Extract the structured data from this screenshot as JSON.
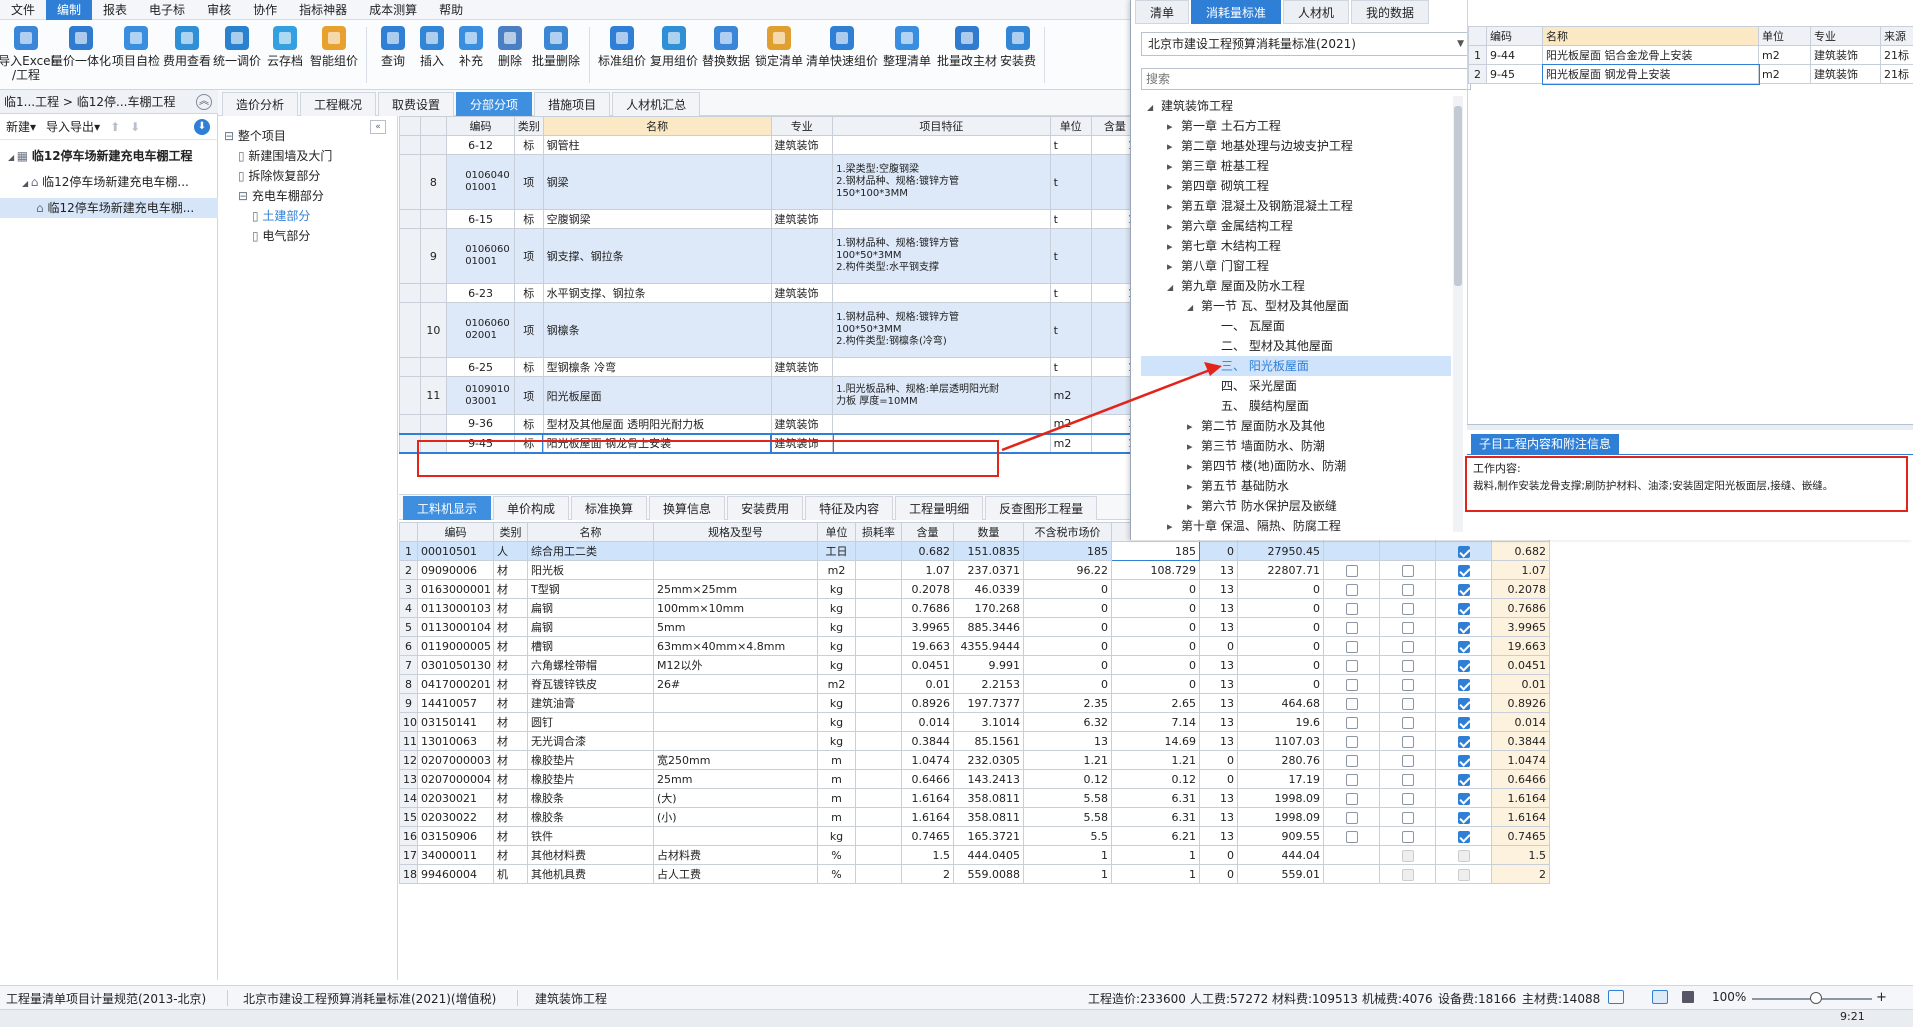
{
  "menu": [
    "文件",
    "编制",
    "报表",
    "电子标",
    "审核",
    "协作",
    "指标神器",
    "成本测算",
    "帮助"
  ],
  "menu_active": "编制",
  "ribbon": [
    {
      "label": "导入Excel\n/工程",
      "color": "#3a86d9",
      "icon": "import-excel-icon"
    },
    {
      "label": "量价一体化",
      "color": "#2e7bd0",
      "icon": "integration-icon"
    },
    {
      "label": "项目自检",
      "color": "#3a8ee0",
      "icon": "self-check-icon"
    },
    {
      "label": "费用查看",
      "color": "#2f90d8",
      "icon": "fee-view-icon"
    },
    {
      "label": "统一调价",
      "color": "#2a82cf",
      "icon": "price-adjust-icon"
    },
    {
      "label": "云存档",
      "color": "#34a0e0",
      "icon": "cloud-archive-icon"
    },
    {
      "label": "智能组价",
      "color": "#e8a12e",
      "icon": "smart-pricing-icon"
    },
    {
      "label": "查询",
      "color": "#2f7fd6",
      "icon": "query-icon"
    },
    {
      "label": "插入",
      "color": "#3386d6",
      "icon": "insert-icon"
    },
    {
      "label": "补充",
      "color": "#3a8ee0",
      "icon": "supplement-icon"
    },
    {
      "label": "删除",
      "color": "#4a7fc4",
      "icon": "delete-icon"
    },
    {
      "label": "批量删除",
      "color": "#3c87d4",
      "icon": "batch-delete-icon"
    },
    {
      "label": "标准组价",
      "color": "#2f7fd6",
      "icon": "standard-pricing-icon"
    },
    {
      "label": "复用组价",
      "color": "#2f90d8",
      "icon": "reuse-pricing-icon"
    },
    {
      "label": "替换数据",
      "color": "#3a86d9",
      "icon": "replace-data-icon"
    },
    {
      "label": "锁定清单",
      "color": "#e0a030",
      "icon": "lock-list-icon"
    },
    {
      "label": "清单快速组价",
      "color": "#2f7fd6",
      "icon": "quick-pricing-icon"
    },
    {
      "label": "整理清单",
      "color": "#3a8ee0",
      "icon": "organize-list-icon"
    },
    {
      "label": "批量改主材",
      "color": "#2e7bd0",
      "icon": "batch-material-icon"
    },
    {
      "label": "安装费",
      "color": "#3386d6",
      "icon": "install-fee-icon"
    }
  ],
  "breadcrumb": "临1...工程 > 临12停...车棚工程",
  "left_toolbar": {
    "new": "新建",
    "io": "导入导出"
  },
  "project_tree": [
    {
      "label": "临12停车场新建充电车棚工程",
      "level": 0
    },
    {
      "label": "临12停车场新建充电车棚...",
      "level": 1
    },
    {
      "label": "临12停车场新建充电车棚...",
      "level": 2
    }
  ],
  "main_tabs": [
    "造价分析",
    "工程概况",
    "取费设置",
    "分部分项",
    "措施项目",
    "人材机汇总"
  ],
  "main_tab_active": "分部分项",
  "section_tree": [
    {
      "label": "整个项目",
      "level": 0
    },
    {
      "label": "新建围墙及大门",
      "level": 1
    },
    {
      "label": "拆除恢复部分",
      "level": 1
    },
    {
      "label": "充电车棚部分",
      "level": 1
    },
    {
      "label": "土建部分",
      "level": 2
    },
    {
      "label": "电气部分",
      "level": 2
    }
  ],
  "upper_grid": {
    "headers": [
      "",
      "",
      "编码",
      "类别",
      "名称",
      "专业",
      "项目特征",
      "单位",
      "含量"
    ],
    "rows": [
      {
        "no": "",
        "code": "6-12",
        "type": "标",
        "name": "钢管柱",
        "spec": "建筑装饰",
        "feature": "",
        "unit": "t",
        "qty": "1",
        "kind": "sub"
      },
      {
        "no": "8",
        "code": "010604001001",
        "type": "项",
        "name": "钢梁",
        "spec": "",
        "feature": "1.梁类型:空腹钢梁\n2.钢材品种、规格:镀锌方管\n150*100*3MM",
        "unit": "t",
        "qty": "",
        "kind": "item3"
      },
      {
        "no": "",
        "code": "6-15",
        "type": "标",
        "name": "空腹钢梁",
        "spec": "建筑装饰",
        "feature": "",
        "unit": "t",
        "qty": "1",
        "kind": "sub"
      },
      {
        "no": "9",
        "code": "010606001001",
        "type": "项",
        "name": "钢支撑、钢拉条",
        "spec": "",
        "feature": "1.钢材品种、规格:镀锌方管\n100*50*3MM\n2.构件类型:水平钢支撑",
        "unit": "t",
        "qty": "",
        "kind": "item3"
      },
      {
        "no": "",
        "code": "6-23",
        "type": "标",
        "name": "水平钢支撑、钢拉条",
        "spec": "建筑装饰",
        "feature": "",
        "unit": "t",
        "qty": "1",
        "kind": "sub"
      },
      {
        "no": "10",
        "code": "010606002001",
        "type": "项",
        "name": "钢檩条",
        "spec": "",
        "feature": "1.钢材品种、规格:镀锌方管\n100*50*3MM\n2.构件类型:钢檩条(冷弯)",
        "unit": "t",
        "qty": "",
        "kind": "item3"
      },
      {
        "no": "",
        "code": "6-25",
        "type": "标",
        "name": "型钢檩条 冷弯",
        "spec": "建筑装饰",
        "feature": "",
        "unit": "t",
        "qty": "1",
        "kind": "sub"
      },
      {
        "no": "11",
        "code": "010901003001",
        "type": "项",
        "name": "阳光板屋面",
        "spec": "",
        "feature": "1.阳光板品种、规格:单层透明阳光耐\n力板 厚度=10MM",
        "unit": "m2",
        "qty": "",
        "kind": "item2"
      },
      {
        "no": "",
        "code": "9-36",
        "type": "标",
        "name": "型材及其他屋面 透明阳光耐力板",
        "spec": "建筑装饰",
        "feature": "",
        "unit": "m2",
        "qty": "1",
        "kind": "sub"
      },
      {
        "no": "",
        "code": "9-45",
        "type": "标",
        "name": "阳光板屋面 钢龙骨上安装",
        "spec": "建筑装饰",
        "feature": "",
        "unit": "m2",
        "qty": "1",
        "kind": "selected"
      }
    ]
  },
  "lower_tabs": [
    "工料机显示",
    "单价构成",
    "标准换算",
    "换算信息",
    "安装费用",
    "特征及内容",
    "工程量明细",
    "反查图形工程量"
  ],
  "lower_tab_active": "工料机显示",
  "lower_grid": {
    "headers": [
      "",
      "编码",
      "类别",
      "名称",
      "规格及型号",
      "单位",
      "损耗率",
      "含量",
      "数量",
      "不含税市场价"
    ],
    "rows": [
      [
        "1",
        "00010501",
        "人",
        "综合用工二类",
        "",
        "工日",
        "",
        "0.682",
        "151.0835",
        "185",
        "185",
        "0",
        "27950.45",
        "",
        "",
        "on",
        "0.682"
      ],
      [
        "2",
        "09090006",
        "材",
        "阳光板",
        "",
        "m2",
        "",
        "1.07",
        "237.0371",
        "96.22",
        "108.729",
        "13",
        "22807.71",
        "off",
        "off",
        "on",
        "1.07"
      ],
      [
        "3",
        "0163000001",
        "材",
        "T型钢",
        "25mm×25mm",
        "kg",
        "",
        "0.2078",
        "46.0339",
        "0",
        "0",
        "13",
        "0",
        "off",
        "off",
        "on",
        "0.2078"
      ],
      [
        "4",
        "0113000103",
        "材",
        "扁钢",
        "100mm×10mm",
        "kg",
        "",
        "0.7686",
        "170.268",
        "0",
        "0",
        "13",
        "0",
        "off",
        "off",
        "on",
        "0.7686"
      ],
      [
        "5",
        "0113000104",
        "材",
        "扁钢",
        "5mm",
        "kg",
        "",
        "3.9965",
        "885.3446",
        "0",
        "0",
        "13",
        "0",
        "off",
        "off",
        "on",
        "3.9965"
      ],
      [
        "6",
        "0119000005",
        "材",
        "槽钢",
        "63mm×40mm×4.8mm",
        "kg",
        "",
        "19.663",
        "4355.9444",
        "0",
        "0",
        "0",
        "0",
        "off",
        "off",
        "on",
        "19.663"
      ],
      [
        "7",
        "0301050130",
        "材",
        "六角螺栓带帽",
        "M12以外",
        "kg",
        "",
        "0.0451",
        "9.991",
        "0",
        "0",
        "13",
        "0",
        "off",
        "off",
        "on",
        "0.0451"
      ],
      [
        "8",
        "0417000201",
        "材",
        "脊瓦镀锌铁皮",
        "26#",
        "m2",
        "",
        "0.01",
        "2.2153",
        "0",
        "0",
        "13",
        "0",
        "off",
        "off",
        "on",
        "0.01"
      ],
      [
        "9",
        "14410057",
        "材",
        "建筑油膏",
        "",
        "kg",
        "",
        "0.8926",
        "197.7377",
        "2.35",
        "2.65",
        "13",
        "464.68",
        "off",
        "off",
        "on",
        "0.8926"
      ],
      [
        "10",
        "03150141",
        "材",
        "圆钉",
        "",
        "kg",
        "",
        "0.014",
        "3.1014",
        "6.32",
        "7.14",
        "13",
        "19.6",
        "off",
        "off",
        "on",
        "0.014"
      ],
      [
        "11",
        "13010063",
        "材",
        "无光调合漆",
        "",
        "kg",
        "",
        "0.3844",
        "85.1561",
        "13",
        "14.69",
        "13",
        "1107.03",
        "off",
        "off",
        "on",
        "0.3844"
      ],
      [
        "12",
        "0207000003",
        "材",
        "橡胶垫片",
        "宽250mm",
        "m",
        "",
        "1.0474",
        "232.0305",
        "1.21",
        "1.21",
        "0",
        "280.76",
        "off",
        "off",
        "on",
        "1.0474"
      ],
      [
        "13",
        "0207000004",
        "材",
        "橡胶垫片",
        "25mm",
        "m",
        "",
        "0.6466",
        "143.2413",
        "0.12",
        "0.12",
        "0",
        "17.19",
        "off",
        "off",
        "on",
        "0.6466"
      ],
      [
        "14",
        "02030021",
        "材",
        "橡胶条",
        "(大)",
        "m",
        "",
        "1.6164",
        "358.0811",
        "5.58",
        "6.31",
        "13",
        "1998.09",
        "off",
        "off",
        "on",
        "1.6164"
      ],
      [
        "15",
        "02030022",
        "材",
        "橡胶条",
        "(小)",
        "m",
        "",
        "1.6164",
        "358.0811",
        "5.58",
        "6.31",
        "13",
        "1998.09",
        "off",
        "off",
        "on",
        "1.6164"
      ],
      [
        "16",
        "03150906",
        "材",
        "铁件",
        "",
        "kg",
        "",
        "0.7465",
        "165.3721",
        "5.5",
        "6.21",
        "13",
        "909.55",
        "off",
        "off",
        "on",
        "0.7465"
      ],
      [
        "17",
        "34000011",
        "材",
        "其他材料费",
        "占材料费",
        "%",
        "",
        "1.5",
        "444.0405",
        "1",
        "1",
        "0",
        "444.04",
        "",
        "dis",
        "dis",
        "1.5"
      ],
      [
        "18",
        "99460004",
        "机",
        "其他机具费",
        "占人工费",
        "%",
        "",
        "2",
        "559.0088",
        "1",
        "1",
        "0",
        "559.01",
        "",
        "dis",
        "dis",
        "2"
      ]
    ]
  },
  "right_panel": {
    "tabs": [
      "清单",
      "消耗量标准",
      "人材机",
      "我的数据"
    ],
    "tab_active": "消耗量标准",
    "standard": "北京市建设工程预算消耗量标准(2021)",
    "search_placeholder": "搜索",
    "tree": [
      {
        "label": "建筑装饰工程",
        "level": 0,
        "arrow": "down"
      },
      {
        "label": "第一章 土石方工程",
        "level": 1,
        "arrow": "right"
      },
      {
        "label": "第二章 地基处理与边坡支护工程",
        "level": 1,
        "arrow": "right"
      },
      {
        "label": "第三章 桩基工程",
        "level": 1,
        "arrow": "right"
      },
      {
        "label": "第四章 砌筑工程",
        "level": 1,
        "arrow": "right"
      },
      {
        "label": "第五章 混凝土及钢筋混凝土工程",
        "level": 1,
        "arrow": "right"
      },
      {
        "label": "第六章 金属结构工程",
        "level": 1,
        "arrow": "right"
      },
      {
        "label": "第七章 木结构工程",
        "level": 1,
        "arrow": "right"
      },
      {
        "label": "第八章 门窗工程",
        "level": 1,
        "arrow": "right"
      },
      {
        "label": "第九章 屋面及防水工程",
        "level": 1,
        "arrow": "down"
      },
      {
        "label": "第一节 瓦、型材及其他屋面",
        "level": 2,
        "arrow": "down"
      },
      {
        "label": "一、 瓦屋面",
        "level": 3,
        "arrow": ""
      },
      {
        "label": "二、 型材及其他屋面",
        "level": 3,
        "arrow": ""
      },
      {
        "label": "三、 阳光板屋面",
        "level": 3,
        "arrow": "",
        "selected": true
      },
      {
        "label": "四、 采光屋面",
        "level": 3,
        "arrow": ""
      },
      {
        "label": "五、 膜结构屋面",
        "level": 3,
        "arrow": ""
      },
      {
        "label": "第二节 屋面防水及其他",
        "level": 2,
        "arrow": "right"
      },
      {
        "label": "第三节 墙面防水、防潮",
        "level": 2,
        "arrow": "right"
      },
      {
        "label": "第四节 楼(地)面防水、防潮",
        "level": 2,
        "arrow": "right"
      },
      {
        "label": "第五节 基础防水",
        "level": 2,
        "arrow": "right"
      },
      {
        "label": "第六节 防水保护层及嵌缝",
        "level": 2,
        "arrow": "right"
      },
      {
        "label": "第十章 保温、隔热、防腐工程",
        "level": 1,
        "arrow": "right"
      }
    ],
    "list_headers": [
      "",
      "编码",
      "名称",
      "单位",
      "专业",
      "来源"
    ],
    "list_rows": [
      [
        "1",
        "9-44",
        "阳光板屋面 铝合金龙骨上安装",
        "m2",
        "建筑装饰",
        "21标"
      ],
      [
        "2",
        "9-45",
        "阳光板屋面 钢龙骨上安装",
        "m2",
        "建筑装饰",
        "21标"
      ]
    ],
    "info_tab": "子目工程内容和附注信息",
    "work_title": "工作内容:",
    "work_content": "裁料,制作安装龙骨支撑;刷防护材料、油漆;安装固定阳光板面层,接缝、嵌缝。"
  },
  "status": {
    "norm1": "工程量清单项目计量规范(2013-北京)",
    "norm2": "北京市建设工程预算消耗量标准(2021)(增值税)",
    "norm3": "建筑装饰工程",
    "total": "工程造价:233600",
    "labor": "人工费:57272",
    "material": "材料费:109513",
    "machine": "机械费:4076",
    "equipment": "设备费:18166",
    "main_material": "主材费:14088",
    "zoom": "100%",
    "time": "9:21"
  }
}
